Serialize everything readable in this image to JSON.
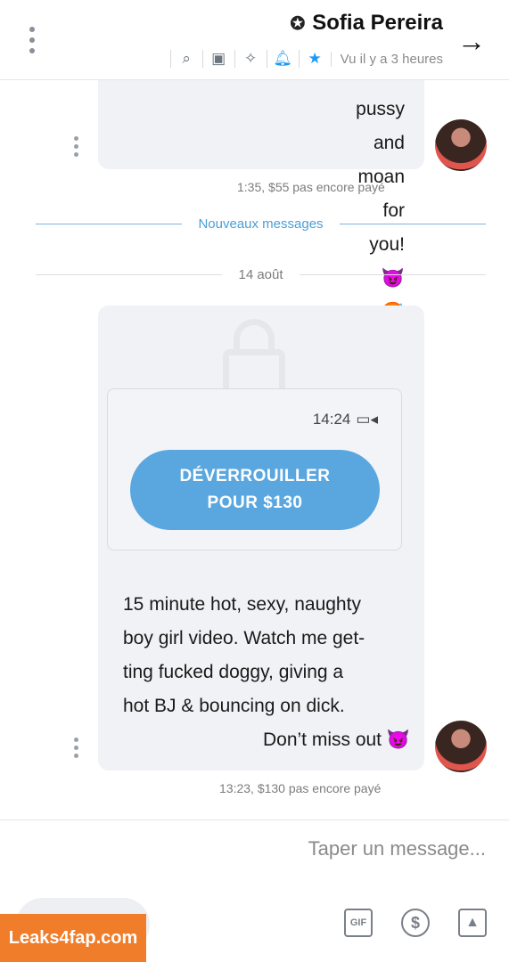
{
  "header": {
    "title": "Sofia Pereira",
    "verified_icon": "verified-badge-icon",
    "last_seen": "Vu il y a 3 heures",
    "icons": [
      "star-icon",
      "bell-icon",
      "pin-icon",
      "media-icon",
      "search-icon"
    ]
  },
  "messages": [
    {
      "text_lines": [
        "pussy and moan for you!😈",
        "🥵"
      ],
      "meta": "1:35,  $55 pas encore payé"
    },
    {
      "media": {
        "duration": "14:24",
        "unlock_line1": "DÉVERROUILLER",
        "unlock_line2": "POUR $130"
      },
      "text_lines": [
        "15 minute hot, sexy, naughty",
        "boy girl video. Watch me get-",
        "ting fucked doggy, giving a",
        "hot BJ & bouncing on dick.",
        "Don’t miss out 😈"
      ],
      "meta": "13:23,  $130 pas encore payé"
    }
  ],
  "dividers": {
    "new_messages": "Nouveaux messages",
    "date": "14 août"
  },
  "composer": {
    "placeholder": "Taper un message...",
    "gif_label": "GIF",
    "dollar_label": "$"
  },
  "watermark": "Leaks4fap.com",
  "colors": {
    "accent": "#5aa7e0",
    "bubble": "#f1f2f5",
    "new_messages_line": "#7fb3d8"
  }
}
